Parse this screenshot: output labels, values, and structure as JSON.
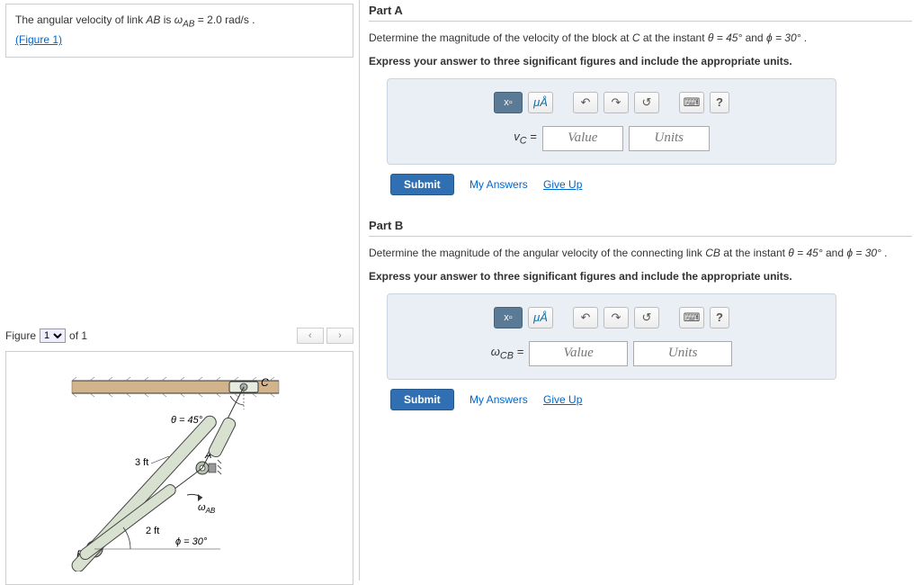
{
  "problem": {
    "prefix": "The angular velocity of link ",
    "link_ab": "AB",
    "mid": " is ",
    "omega_ab": "ω",
    "ab_sub": "AB",
    "equals": " = 2.0 rad/s .",
    "figure_link": "(Figure 1)"
  },
  "figure_selector": {
    "label_left": "Figure",
    "option": "1",
    "label_right": "of 1",
    "prev": "‹",
    "next": "›"
  },
  "diagram": {
    "theta_label": "θ = 45°",
    "phi_label": "ϕ = 30°",
    "omega_label": "ω",
    "omega_sub": "AB",
    "len_CA": "3 ft",
    "len_AB": "2 ft",
    "pt_A": "A",
    "pt_B": "B",
    "pt_C": "C"
  },
  "toolbar": {
    "templates": "x▫",
    "mu": "μÅ",
    "undo": "↶",
    "redo": "↷",
    "reset": "↺",
    "keyboard": "⌨",
    "help": "?"
  },
  "partA": {
    "header": "Part A",
    "q1": "Determine the magnitude of the velocity of the block at ",
    "q_var": "C",
    "q2": " at the instant ",
    "theta": "θ = 45°",
    "and": " and ",
    "phi": "ϕ = 30°",
    "period": " .",
    "instruct": "Express your answer to three significant figures and include the appropriate units.",
    "var": "v",
    "var_sub": "C",
    "eq": " = ",
    "value_ph": "Value",
    "units_ph": "Units"
  },
  "partB": {
    "header": "Part B",
    "q1": "Determine the magnitude of the angular velocity of the connecting link ",
    "q_var": "CB",
    "q2": " at the instant ",
    "theta": "θ = 45°",
    "and": " and ",
    "phi": "ϕ = 30°",
    "period": " .",
    "instruct": "Express your answer to three significant figures and include the appropriate units.",
    "var": "ω",
    "var_sub": "CB",
    "eq": " = ",
    "value_ph": "Value",
    "units_ph": "Units"
  },
  "actions": {
    "submit": "Submit",
    "my_answers": "My Answers",
    "give_up": "Give Up"
  }
}
